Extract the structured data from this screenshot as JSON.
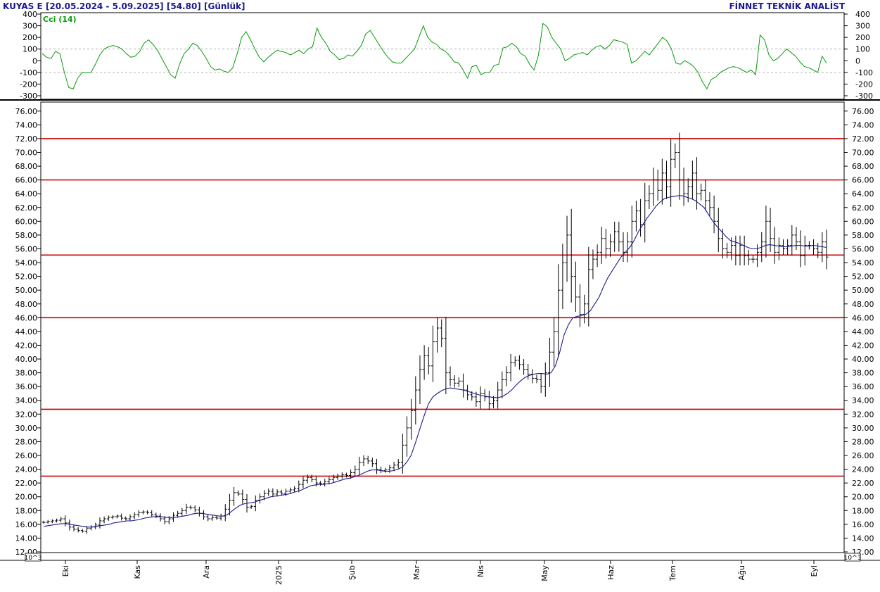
{
  "header": {
    "symbol": "KUYAS E",
    "range": "[20.05.2024 - 5.09.2025]",
    "last": "[54.80]",
    "period": "[Günlük]",
    "brand": "FİNNET TEKNİK ANALİST"
  },
  "indicator": {
    "name": "Cci (14)",
    "color": "#0a9a0a",
    "ylim": [
      -300,
      400
    ],
    "ticks": [
      "400",
      "300",
      "200",
      "100",
      "0",
      "-100",
      "-200",
      "-300"
    ],
    "ref_levels": [
      100,
      -100
    ]
  },
  "price_axis": {
    "ticks": [
      "76.00",
      "74.00",
      "72.00",
      "70.00",
      "68.00",
      "66.00",
      "64.00",
      "62.00",
      "60.00",
      "58.00",
      "56.00",
      "54.00",
      "52.00",
      "50.00",
      "48.00",
      "46.00",
      "44.00",
      "42.00",
      "40.00",
      "38.00",
      "36.00",
      "34.00",
      "32.00",
      "30.00",
      "28.00",
      "26.00",
      "24.00",
      "22.00",
      "20.00",
      "18.00",
      "16.00",
      "14.00",
      "12.00"
    ],
    "scale_note": "10^3"
  },
  "x_axis": {
    "labels": [
      "Eki",
      "Kas",
      "Ara",
      "2025",
      "Şub",
      "Mar",
      "Nis",
      "May",
      "Haz",
      "Tem",
      "Ağu",
      "Eyl"
    ]
  },
  "colors": {
    "border": "#000000",
    "support_lines": "#cc0000",
    "moving_average": "#1a1a8c",
    "bars": "#000000",
    "grid": "#999999"
  },
  "chart_data": {
    "type": "ohlc",
    "title": "KUYAS E",
    "ylim": [
      12,
      77
    ],
    "horizontal_levels": [
      72.0,
      66.0,
      55.1,
      46.0,
      32.7,
      23.0
    ],
    "price_series": {
      "name": "KUYAS E",
      "close_approx": [
        16.3,
        16.4,
        16.5,
        16.6,
        16.8,
        16.2,
        15.6,
        15.3,
        15.1,
        15.0,
        15.4,
        15.6,
        15.9,
        16.5,
        16.8,
        17.0,
        17.1,
        17.2,
        16.9,
        16.8,
        17.1,
        17.4,
        17.7,
        17.8,
        17.7,
        17.4,
        17.2,
        16.8,
        16.4,
        16.8,
        17.3,
        17.6,
        18.0,
        18.5,
        18.4,
        18.1,
        17.6,
        17.1,
        16.8,
        17.0,
        16.9,
        17.2,
        18.2,
        19.5,
        20.6,
        20.4,
        19.6,
        18.5,
        18.6,
        19.5,
        20.0,
        20.5,
        20.8,
        20.4,
        20.7,
        20.5,
        20.8,
        21.0,
        21.2,
        21.8,
        22.4,
        22.8,
        22.5,
        22.0,
        21.9,
        22.2,
        22.5,
        22.8,
        23.0,
        23.2,
        23.1,
        23.5,
        24.0,
        25.0,
        25.5,
        25.2,
        24.8,
        24.0,
        23.8,
        23.9,
        24.2,
        24.6,
        25.0,
        27.5,
        30.0,
        32.5,
        35.5,
        38.5,
        40.5,
        39.0,
        42.5,
        44.5,
        43.0,
        38.0,
        37.0,
        36.5,
        36.8,
        35.5,
        34.8,
        34.5,
        33.8,
        35.0,
        34.5,
        33.5,
        34.0,
        35.5,
        37.0,
        38.0,
        39.5,
        39.8,
        39.2,
        38.5,
        37.8,
        37.2,
        37.0,
        36.0,
        38.0,
        41.0,
        44.0,
        50.0,
        54.0,
        58.0,
        52.0,
        49.0,
        46.5,
        48.0,
        53.0,
        54.5,
        55.5,
        57.5,
        56.0,
        57.0,
        58.5,
        57.0,
        55.5,
        57.0,
        60.0,
        61.5,
        59.5,
        63.0,
        64.0,
        66.0,
        64.5,
        67.0,
        65.0,
        69.0,
        70.0,
        66.0,
        64.0,
        65.0,
        67.0,
        64.0,
        64.5,
        63.0,
        62.0,
        60.0,
        57.5,
        56.0,
        55.5,
        56.5,
        55.0,
        56.5,
        55.0,
        54.5,
        54.5,
        55.5,
        57.0,
        60.0,
        57.5,
        55.5,
        56.5,
        56.0,
        56.5,
        58.0,
        57.0,
        55.0,
        56.5,
        56.5,
        56.0,
        55.5,
        57.0,
        54.8
      ],
      "high_low_note": "Daily OHLC bars"
    },
    "moving_average": {
      "name": "MA",
      "values_approx": [
        15.7,
        15.8,
        15.9,
        16.0,
        16.1,
        16.1,
        16.0,
        15.9,
        15.8,
        15.7,
        15.6,
        15.6,
        15.7,
        15.8,
        15.9,
        16.0,
        16.2,
        16.3,
        16.4,
        16.5,
        16.5,
        16.6,
        16.7,
        16.9,
        17.0,
        17.1,
        17.1,
        17.1,
        17.0,
        17.0,
        17.0,
        17.1,
        17.2,
        17.3,
        17.5,
        17.6,
        17.6,
        17.5,
        17.4,
        17.3,
        17.2,
        17.2,
        17.4,
        17.9,
        18.4,
        18.8,
        19.0,
        19.1,
        19.2,
        19.4,
        19.6,
        19.8,
        20.0,
        20.1,
        20.2,
        20.3,
        20.4,
        20.6,
        20.8,
        21.0,
        21.3,
        21.6,
        21.7,
        21.8,
        21.8,
        21.9,
        22.0,
        22.2,
        22.4,
        22.6,
        22.7,
        22.9,
        23.1,
        23.4,
        23.7,
        23.9,
        23.9,
        23.8,
        23.7,
        23.7,
        23.8,
        24.0,
        24.3,
        25.0,
        26.0,
        27.8,
        29.8,
        31.8,
        33.5,
        34.5,
        35.0,
        35.4,
        35.7,
        35.8,
        35.7,
        35.6,
        35.5,
        35.3,
        35.1,
        34.9,
        34.7,
        34.6,
        34.5,
        34.4,
        34.4,
        34.6,
        35.0,
        35.5,
        36.2,
        36.8,
        37.3,
        37.6,
        37.8,
        37.9,
        37.9,
        37.8,
        38.0,
        39.0,
        41.0,
        43.5,
        45.0,
        46.0,
        46.2,
        46.3,
        46.5,
        47.0,
        48.0,
        49.0,
        50.5,
        51.8,
        52.8,
        53.8,
        54.8,
        55.5,
        56.2,
        57.2,
        58.5,
        59.5,
        60.5,
        61.3,
        62.2,
        62.8,
        63.3,
        63.5,
        63.6,
        63.7,
        63.7,
        63.5,
        63.3,
        63.0,
        62.5,
        62.0,
        61.0,
        60.0,
        59.2,
        58.5,
        57.8,
        57.2,
        57.0,
        56.8,
        56.5,
        56.2,
        56.0,
        56.0,
        56.2,
        56.5,
        56.6,
        56.5,
        56.4,
        56.3,
        56.3,
        56.4,
        56.5,
        56.5,
        56.4,
        56.4,
        56.5,
        56.4,
        56.3,
        56.2
      ]
    },
    "cci_series": {
      "name": "Cci (14)",
      "values_approx": [
        60,
        30,
        20,
        80,
        60,
        -100,
        -230,
        -240,
        -150,
        -100,
        -100,
        -100,
        -30,
        50,
        100,
        120,
        130,
        120,
        100,
        60,
        30,
        40,
        80,
        150,
        180,
        140,
        90,
        20,
        -50,
        -120,
        -150,
        -30,
        60,
        100,
        150,
        130,
        80,
        20,
        -50,
        -80,
        -70,
        -90,
        -100,
        -60,
        60,
        200,
        250,
        180,
        100,
        30,
        -10,
        30,
        60,
        90,
        80,
        70,
        50,
        70,
        90,
        60,
        100,
        120,
        280,
        200,
        150,
        80,
        50,
        10,
        20,
        50,
        40,
        80,
        130,
        230,
        260,
        200,
        140,
        80,
        30,
        -10,
        -20,
        -20,
        20,
        60,
        100,
        200,
        300,
        200,
        160,
        140,
        100,
        80,
        40,
        -10,
        -20,
        -80,
        -150,
        -50,
        -40,
        -120,
        -100,
        -100,
        -40,
        -30,
        110,
        120,
        150,
        120,
        60,
        40,
        -30,
        -80,
        50,
        320,
        290,
        200,
        150,
        100,
        0,
        20,
        50,
        60,
        70,
        50,
        90,
        120,
        130,
        100,
        130,
        180,
        170,
        160,
        140,
        -20,
        0,
        40,
        80,
        50,
        100,
        150,
        200,
        170,
        100,
        -20,
        -30,
        0,
        -20,
        -50,
        -100,
        -180,
        -240,
        -160,
        -140,
        -100,
        -80,
        -60,
        -50,
        -60,
        -80,
        -100,
        -80,
        -120,
        220,
        180,
        50,
        0,
        20,
        60,
        100,
        70,
        40,
        -10,
        -50,
        -60,
        -80,
        -100,
        40,
        -20
      ]
    }
  }
}
